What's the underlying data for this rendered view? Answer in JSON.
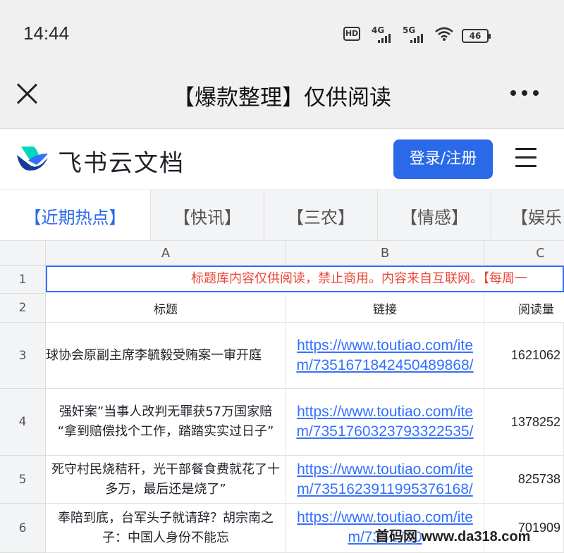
{
  "status_bar": {
    "time": "14:44",
    "hd_label": "HD",
    "sig1_label": "4G",
    "sig2_label": "5G",
    "battery": "46"
  },
  "title_bar": {
    "title": "【爆款整理】仅供阅读"
  },
  "app_header": {
    "brand": "飞书云文档",
    "login_label": "登录/注册"
  },
  "tabs": [
    "【近期热点】",
    "【快讯】",
    "【三农】",
    "【情感】",
    "【娱乐"
  ],
  "sheet": {
    "columns": [
      "A",
      "B",
      "C"
    ],
    "rows": [
      "1",
      "2",
      "3",
      "4",
      "5",
      "6"
    ],
    "notice": "标题库内容仅供阅读，禁止商用。内容来自互联网。【每周一",
    "headers": [
      "标题",
      "链接",
      "阅读量"
    ],
    "records": [
      {
        "title": "球协会原副主席李毓毅受贿案一审开庭",
        "link": "https://www.toutiao.com/item/7351671842450489868/",
        "reads": "1621062"
      },
      {
        "title": "强奸案”当事人改判无罪获57万国家赔 “拿到赔偿找个工作，踏踏实实过日子”",
        "link": "https://www.toutiao.com/item/7351760323793322535/",
        "reads": "1378252"
      },
      {
        "title": "死守村民烧秸秆，光干部餐食费就花了十多万，最后还是烧了”",
        "link": "https://www.toutiao.com/item/7351623911995376168/",
        "reads": "825738"
      },
      {
        "title": "奉陪到底，台军头子就请辞？胡宗南之子：中国人身份不能忘",
        "link": "https://www.toutiao.com/item/7351730",
        "reads": "701909"
      }
    ]
  },
  "watermark": "首码网 www.da318.com"
}
